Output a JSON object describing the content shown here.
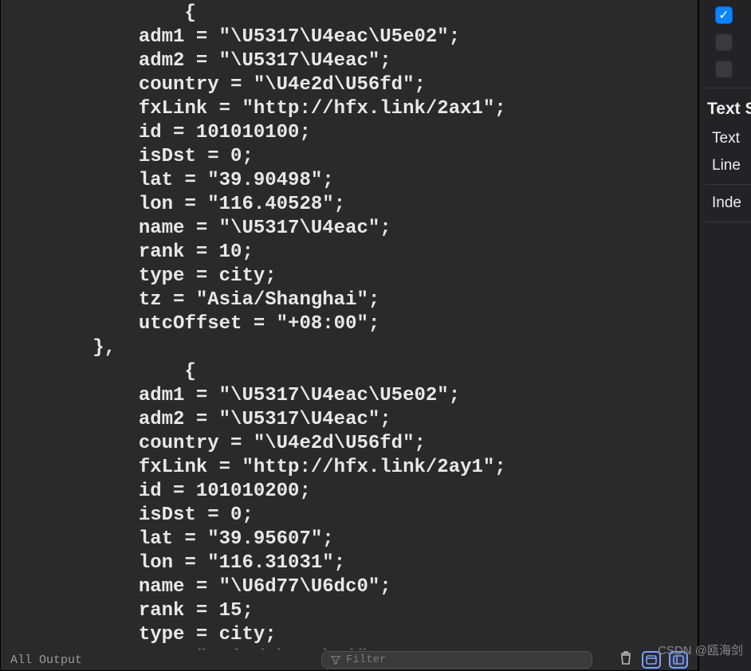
{
  "code": {
    "indent_block": "        ",
    "indent_open": "                ",
    "indent_close": "        ",
    "indent_kv": "            ",
    "entries": [
      {
        "kv": [
          {
            "k": "adm1",
            "v": "\"\\U5317\\U4eac\\U5e02\""
          },
          {
            "k": "adm2",
            "v": "\"\\U5317\\U4eac\""
          },
          {
            "k": "country",
            "v": "\"\\U4e2d\\U56fd\""
          },
          {
            "k": "fxLink",
            "v": "\"http://hfx.link/2ax1\""
          },
          {
            "k": "id",
            "v": "101010100"
          },
          {
            "k": "isDst",
            "v": "0"
          },
          {
            "k": "lat",
            "v": "\"39.90498\""
          },
          {
            "k": "lon",
            "v": "\"116.40528\""
          },
          {
            "k": "name",
            "v": "\"\\U5317\\U4eac\""
          },
          {
            "k": "rank",
            "v": "10"
          },
          {
            "k": "type",
            "v": "city"
          },
          {
            "k": "tz",
            "v": "\"Asia/Shanghai\""
          },
          {
            "k": "utcOffset",
            "v": "\"+08:00\""
          }
        ],
        "close": "},"
      },
      {
        "kv": [
          {
            "k": "adm1",
            "v": "\"\\U5317\\U4eac\\U5e02\""
          },
          {
            "k": "adm2",
            "v": "\"\\U5317\\U4eac\""
          },
          {
            "k": "country",
            "v": "\"\\U4e2d\\U56fd\""
          },
          {
            "k": "fxLink",
            "v": "\"http://hfx.link/2ay1\""
          },
          {
            "k": "id",
            "v": "101010200"
          },
          {
            "k": "isDst",
            "v": "0"
          },
          {
            "k": "lat",
            "v": "\"39.95607\""
          },
          {
            "k": "lon",
            "v": "\"116.31031\""
          },
          {
            "k": "name",
            "v": "\"\\U6d77\\U6dc0\""
          },
          {
            "k": "rank",
            "v": "15"
          },
          {
            "k": "type",
            "v": "city"
          },
          {
            "k": "tz",
            "v": "\"Asia/Shanghai\""
          }
        ]
      }
    ]
  },
  "bottom_bar": {
    "left_label": "All Output",
    "filter_placeholder": "Filter"
  },
  "inspector": {
    "checks": [
      {
        "checked": true
      },
      {
        "checked": false
      },
      {
        "checked": false
      }
    ],
    "section_title": "Text Settings",
    "labels": [
      "Text",
      "Line",
      "Inde"
    ]
  },
  "watermark": "CSDN @瓯海剑"
}
